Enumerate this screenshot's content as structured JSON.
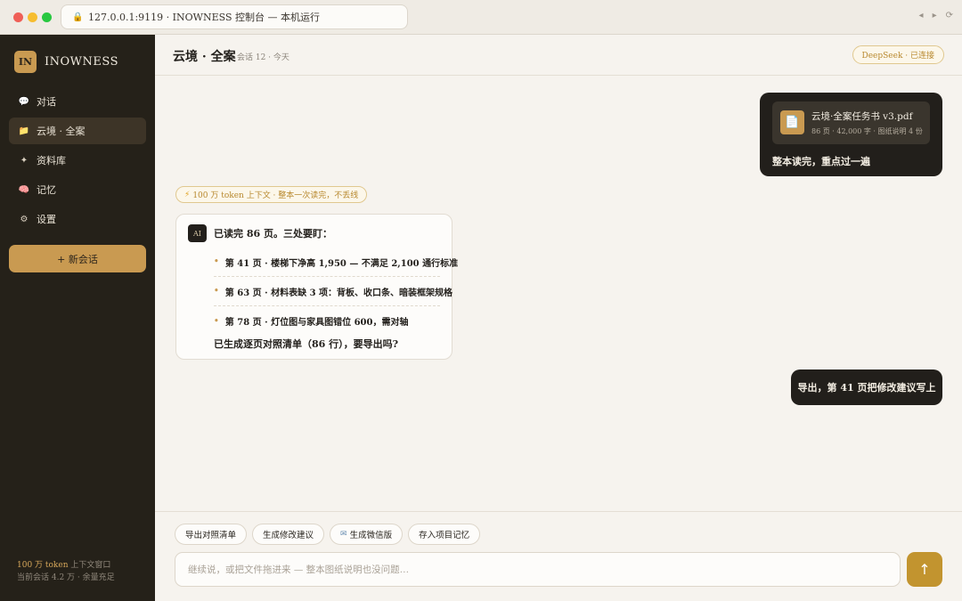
{
  "browser": {
    "url": "127.0.0.1:9119 · INOWNESS 控制台 — 本机运行",
    "back": "◂",
    "forward": "▸",
    "reload": "⟳"
  },
  "sidebar": {
    "brand_logo": "IN",
    "brand_name": "INOWNESS",
    "items": [
      {
        "icon": "💬",
        "icon_name": "chat-bubble-icon",
        "label": "对话"
      },
      {
        "icon": "📁",
        "icon_name": "folder-icon",
        "label": "云境 · 全案"
      },
      {
        "icon": "✦",
        "icon_name": "sparkle-icon",
        "label": "资料库"
      },
      {
        "icon": "🧠",
        "icon_name": "brain-icon",
        "label": "记忆"
      },
      {
        "icon": "⚙",
        "icon_name": "gear-icon",
        "label": "设置"
      }
    ],
    "active_index": 1,
    "new_chat": "+ 新会话",
    "footer_highlight": "100 万 token",
    "footer_line1_rest": " 上下文窗口",
    "footer_line2": "当前会话 4.2 万 · 余量充足"
  },
  "header": {
    "title": "云境 · 全案",
    "meta": "会话 12 · 今天",
    "connection_badge": "DeepSeek · 已连接"
  },
  "messages": {
    "file": {
      "icon": "📄",
      "name": "云境·全案任务书 v3.pdf",
      "meta": "86 页 · 42,000 字 · 图纸说明 4 份"
    },
    "user_text_1": "整本读完，重点过一遍",
    "context_chip_icon": "⚡",
    "context_chip": "100 万 token 上下文 · 整本一次读完，不丢线",
    "ai_avatar": "AI",
    "ai_intro": "已读完 86 页。三处要盯：",
    "ai_points": [
      "第 41 页 · 楼梯下净高 1,950 — 不满足 2,100 通行标准",
      "第 63 页 · 材料表缺 3 项：背板、收口条、暗装框架规格",
      "第 78 页 · 灯位图与家具图错位 600，需对轴"
    ],
    "ai_outro": "已生成逐页对照清单（86 行），要导出吗?",
    "user_text_2": "导出，第 41 页把修改建议写上"
  },
  "composer": {
    "quick_actions": [
      {
        "label": "导出对照清单",
        "icon": ""
      },
      {
        "label": "生成修改建议",
        "icon": ""
      },
      {
        "label": "生成微信版",
        "icon": "✉"
      },
      {
        "label": "存入项目记忆",
        "icon": ""
      }
    ],
    "placeholder": "继续说，或把文件拖进来 — 整本图纸说明也没问题…",
    "send_icon": "↑"
  },
  "colors": {
    "sidebar_bg": "#252119",
    "accent_gold": "#c99a51",
    "send_button": "#c2942f",
    "bubble_dark": "#221f1b",
    "page_bg": "#f6f3ee"
  }
}
